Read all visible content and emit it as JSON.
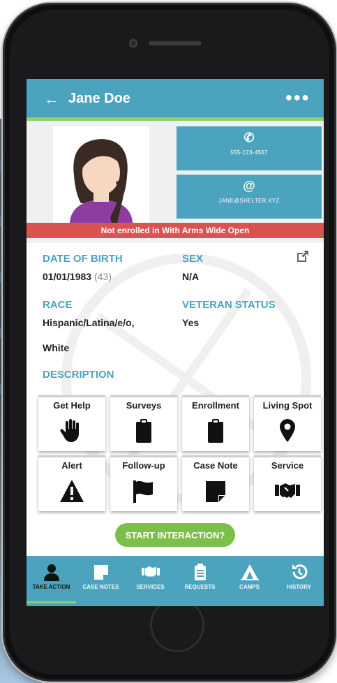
{
  "header": {
    "title": "Jane Doe",
    "back_icon": "arrow-left-icon",
    "more_icon": "more-horizontal-icon"
  },
  "contact": {
    "phone": {
      "value": "555-123-4567",
      "icon": "phone-icon"
    },
    "email": {
      "value": "JANE@SHELTER.XYZ",
      "icon": "at-sign-icon"
    }
  },
  "banner": "Not enrolled in With Arms Wide Open",
  "profile": {
    "dob_label": "DATE OF BIRTH",
    "dob_value": "01/01/1983",
    "age": "(43)",
    "sex_label": "SEX",
    "sex_value": "N/A",
    "race_label": "RACE",
    "race_value_1": "Hispanic/Latina/e/o,",
    "race_value_2": "White",
    "veteran_label": "VETERAN STATUS",
    "veteran_value": "Yes",
    "description_label": "DESCRIPTION"
  },
  "actions": [
    {
      "label": "Get Help",
      "icon": "hand-icon"
    },
    {
      "label": "Surveys",
      "icon": "clipboard-icon"
    },
    {
      "label": "Enrollment",
      "icon": "clipboard-icon"
    },
    {
      "label": "Living Spot",
      "icon": "map-pin-icon"
    },
    {
      "label": "Alert",
      "icon": "warning-icon"
    },
    {
      "label": "Follow-up",
      "icon": "flag-icon"
    },
    {
      "label": "Case Note",
      "icon": "note-icon"
    },
    {
      "label": "Service",
      "icon": "handshake-icon"
    }
  ],
  "start_button": "START INTERACTION?",
  "tabs": [
    {
      "label": "TAKE ACTION",
      "icon": "person-icon",
      "active": true
    },
    {
      "label": "CASE NOTES",
      "icon": "note-icon"
    },
    {
      "label": "SERVICES",
      "icon": "handshake-icon"
    },
    {
      "label": "REQUESTS",
      "icon": "clipboard-icon"
    },
    {
      "label": "CAMPS",
      "icon": "tent-icon"
    },
    {
      "label": "HISTORY",
      "icon": "history-icon"
    }
  ],
  "colors": {
    "primary": "#4ba3be",
    "accent": "#8fd06a",
    "alert": "#d9534f",
    "start": "#7cbf4a"
  }
}
